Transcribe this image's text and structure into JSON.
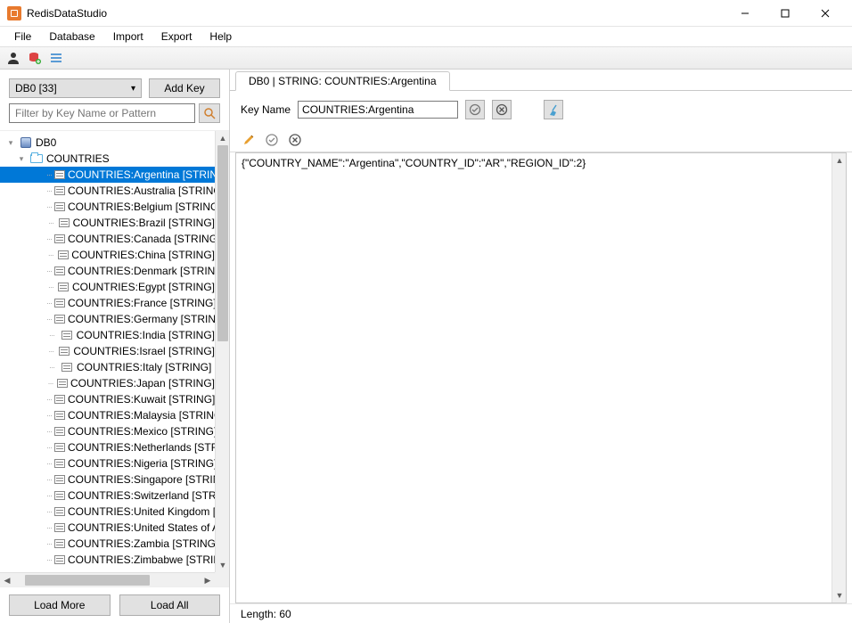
{
  "window": {
    "title": "RedisDataStudio"
  },
  "menu": {
    "items": [
      "File",
      "Database",
      "Import",
      "Export",
      "Help"
    ]
  },
  "toolbar_icons": [
    "user-icon",
    "db-add-icon",
    "list-icon"
  ],
  "sidebar": {
    "db_selector": "DB0 [33]",
    "add_key_label": "Add Key",
    "filter_placeholder": "Filter by Key Name or Pattern",
    "root_label": "DB0",
    "folder_label": "COUNTRIES",
    "keys": [
      {
        "label": "COUNTRIES:Argentina [STRING]",
        "selected": true
      },
      {
        "label": "COUNTRIES:Australia [STRING]"
      },
      {
        "label": "COUNTRIES:Belgium [STRING]"
      },
      {
        "label": "COUNTRIES:Brazil [STRING]"
      },
      {
        "label": "COUNTRIES:Canada [STRING]"
      },
      {
        "label": "COUNTRIES:China [STRING]"
      },
      {
        "label": "COUNTRIES:Denmark [STRING]"
      },
      {
        "label": "COUNTRIES:Egypt [STRING]"
      },
      {
        "label": "COUNTRIES:France [STRING]"
      },
      {
        "label": "COUNTRIES:Germany [STRING]"
      },
      {
        "label": "COUNTRIES:India [STRING]"
      },
      {
        "label": "COUNTRIES:Israel [STRING]"
      },
      {
        "label": "COUNTRIES:Italy [STRING]"
      },
      {
        "label": "COUNTRIES:Japan [STRING]"
      },
      {
        "label": "COUNTRIES:Kuwait [STRING]"
      },
      {
        "label": "COUNTRIES:Malaysia [STRING]"
      },
      {
        "label": "COUNTRIES:Mexico [STRING]"
      },
      {
        "label": "COUNTRIES:Netherlands [STRING]"
      },
      {
        "label": "COUNTRIES:Nigeria [STRING]"
      },
      {
        "label": "COUNTRIES:Singapore [STRING]"
      },
      {
        "label": "COUNTRIES:Switzerland [STRING]"
      },
      {
        "label": "COUNTRIES:United Kingdom [STRING]"
      },
      {
        "label": "COUNTRIES:United States of America [STRING]"
      },
      {
        "label": "COUNTRIES:Zambia [STRING]"
      },
      {
        "label": "COUNTRIES:Zimbabwe [STRING]"
      }
    ],
    "load_more_label": "Load More",
    "load_all_label": "Load All"
  },
  "content": {
    "tab_label": "DB0 | STRING: COUNTRIES:Argentina",
    "key_name_label": "Key Name",
    "key_name_value": "COUNTRIES:Argentina",
    "value_text": "{\"COUNTRY_NAME\":\"Argentina\",\"COUNTRY_ID\":\"AR\",\"REGION_ID\":2}",
    "status_text": "Length: 60"
  }
}
